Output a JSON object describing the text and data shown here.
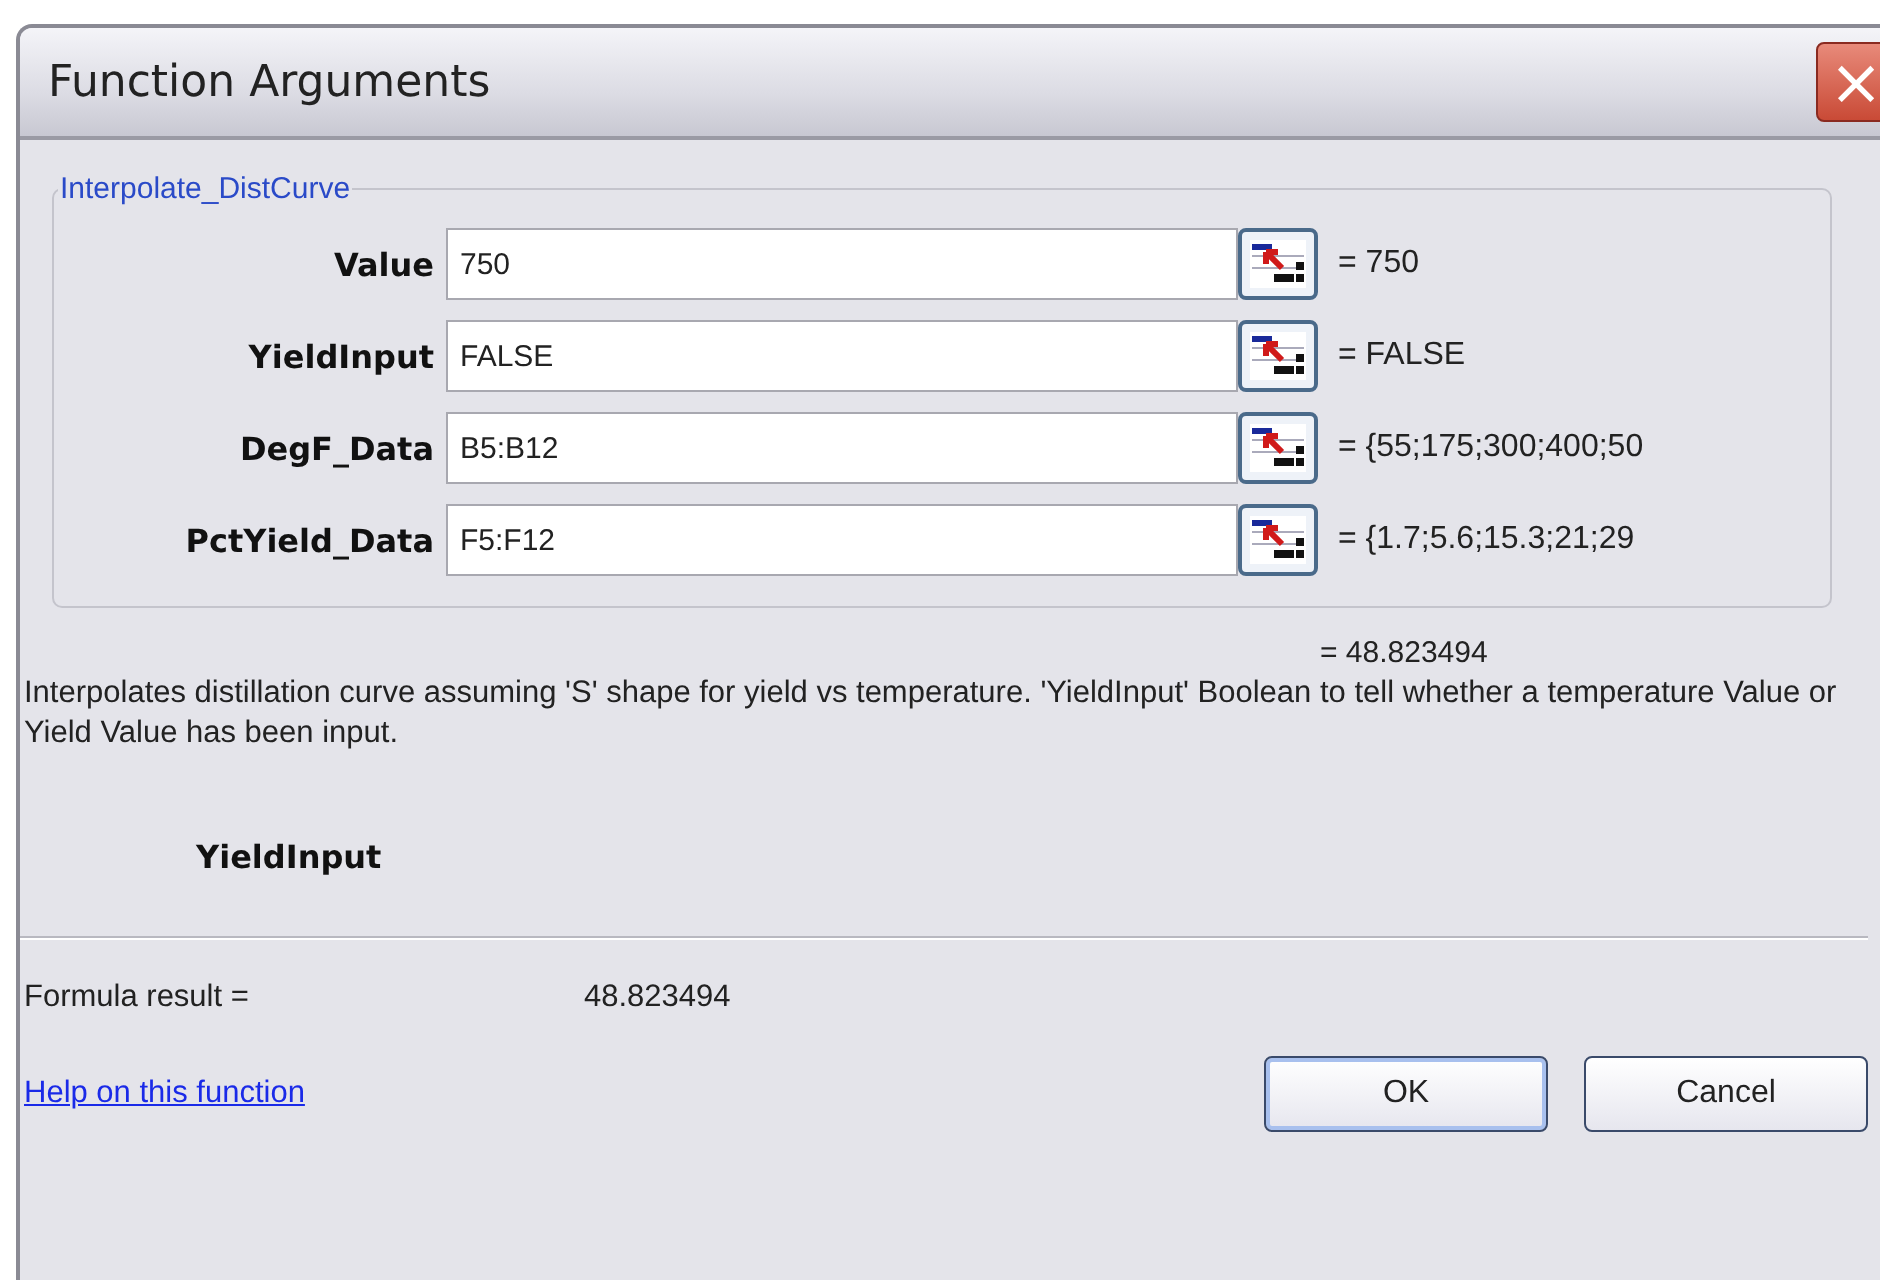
{
  "window": {
    "title": "Function Arguments",
    "close": "×"
  },
  "group": {
    "title": "Interpolate_DistCurve",
    "arguments": [
      {
        "label": "Value",
        "value": "750",
        "result": "= 750"
      },
      {
        "label": "YieldInput",
        "value": "FALSE",
        "result": "= FALSE"
      },
      {
        "label": "DegF_Data",
        "value": "B5:B12",
        "result": "= {55;175;300;400;50"
      },
      {
        "label": "PctYield_Data",
        "value": "F5:F12",
        "result": "= {1.7;5.6;15.3;21;29"
      }
    ]
  },
  "function_result": "= 48.823494",
  "description": "Interpolates distillation curve assuming 'S' shape for yield vs temperature. 'YieldInput' Boolean to tell whether a temperature Value or Yield Value has been input.",
  "argument_name": "YieldInput",
  "formula_result": {
    "label": "Formula result =",
    "value": "48.823494"
  },
  "help_link": "Help on this function",
  "buttons": [
    "OK",
    "Cancel"
  ]
}
